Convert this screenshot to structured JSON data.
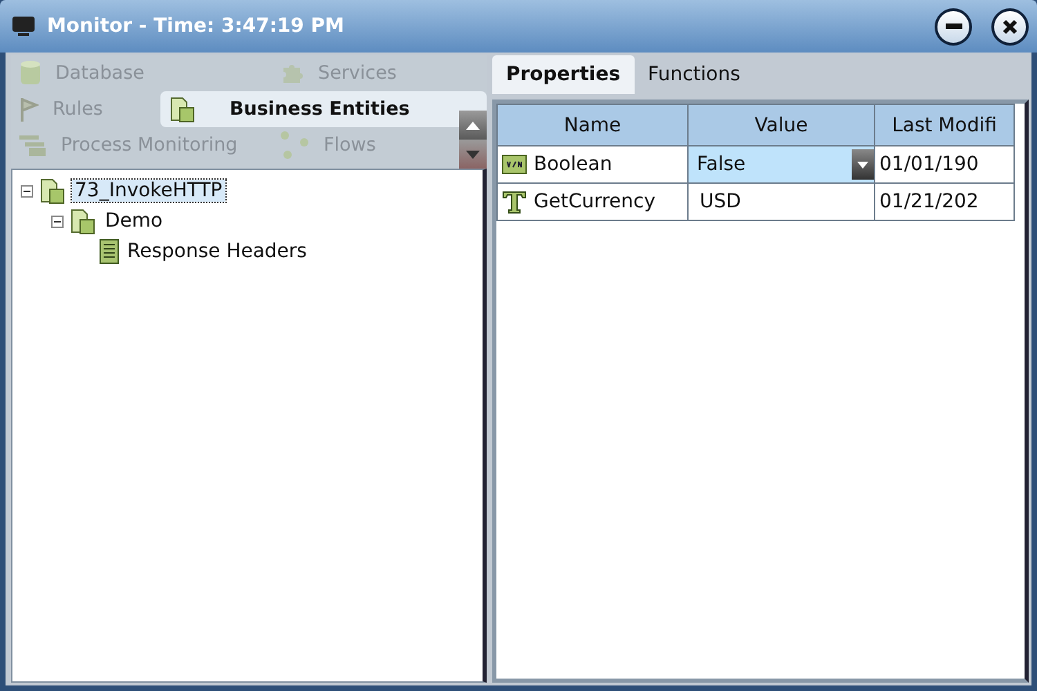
{
  "window": {
    "title": "Monitor - Time: 3:47:19 PM"
  },
  "categories": [
    {
      "label": "Database",
      "kind": "database",
      "selected": false
    },
    {
      "label": "Services",
      "kind": "services",
      "selected": false
    },
    {
      "label": "Rules",
      "kind": "rules",
      "selected": false
    },
    {
      "label": "Business Entities",
      "kind": "entities",
      "selected": true
    },
    {
      "label": "Process Monitoring",
      "kind": "process",
      "selected": false
    },
    {
      "label": "Flows",
      "kind": "flows",
      "selected": false
    }
  ],
  "tree": [
    {
      "label": "73_InvokeHTTP",
      "kind": "entity",
      "expanded": true,
      "selected": true,
      "children": [
        {
          "label": "Demo",
          "kind": "entity",
          "expanded": true,
          "selected": false,
          "children": [
            {
              "label": "Response Headers",
              "kind": "list",
              "selected": false
            }
          ]
        }
      ]
    }
  ],
  "tabs": [
    {
      "label": "Properties",
      "selected": true
    },
    {
      "label": "Functions",
      "selected": false
    }
  ],
  "table": {
    "columns": [
      "Name",
      "Value",
      "Last Modifi"
    ],
    "rows": [
      {
        "kind": "boolean",
        "name": "Boolean",
        "value": "False",
        "dropdown": true,
        "modified": "01/01/190"
      },
      {
        "kind": "text",
        "name": "GetCurrency",
        "value": "USD",
        "dropdown": false,
        "modified": "01/21/202"
      }
    ]
  }
}
